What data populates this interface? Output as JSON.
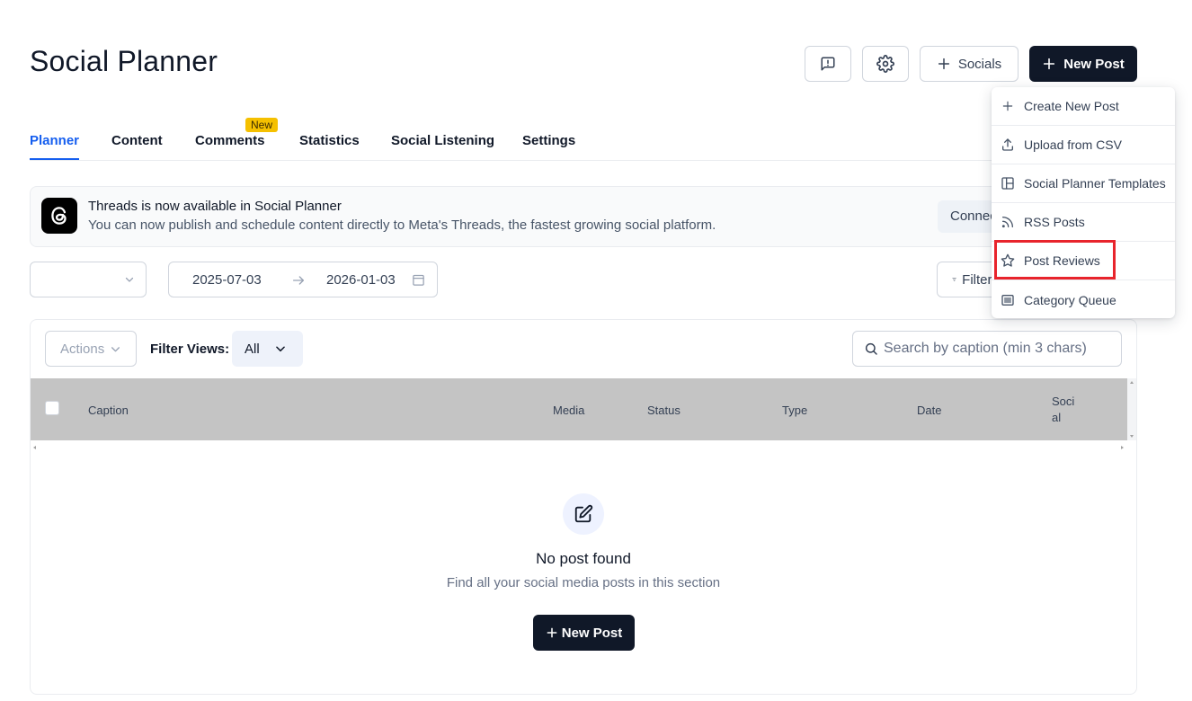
{
  "header": {
    "title": "Social Planner",
    "socials_label": "Socials",
    "new_post_label": "New Post"
  },
  "tabs": [
    {
      "label": "Planner",
      "active": true
    },
    {
      "label": "Content"
    },
    {
      "label": "Comments",
      "badge": "New"
    },
    {
      "label": "Statistics"
    },
    {
      "label": "Social Listening"
    },
    {
      "label": "Settings"
    }
  ],
  "banner": {
    "title": "Threads is now available in Social Planner",
    "text": "You can now publish and schedule content directly to Meta's Threads, the fastest growing social platform.",
    "connect_label": "Connect"
  },
  "filters": {
    "date_start": "2025-07-03",
    "date_end": "2026-01-03",
    "filter_label": "Filters"
  },
  "table": {
    "actions_label": "Actions",
    "filter_views_label": "Filter Views:",
    "filter_views_value": "All",
    "search_placeholder": "Search by caption (min 3 chars)",
    "columns": [
      "Caption",
      "Media",
      "Status",
      "Type",
      "Date",
      "Social"
    ]
  },
  "empty_state": {
    "title": "No post found",
    "subtitle": "Find all your social media posts in this section",
    "button_label": "New Post"
  },
  "dropdown": {
    "items": [
      {
        "label": "Create New Post",
        "icon": "plus-icon"
      },
      {
        "label": "Upload from CSV",
        "icon": "upload-icon"
      },
      {
        "label": "Social Planner Templates",
        "icon": "template-icon"
      },
      {
        "label": "RSS Posts",
        "icon": "rss-icon"
      },
      {
        "label": "Post Reviews",
        "icon": "star-icon",
        "highlighted": true
      },
      {
        "label": "Category Queue",
        "icon": "queue-icon"
      }
    ]
  },
  "colors": {
    "accent": "#155eef",
    "dark_button": "#101828",
    "badge": "#f5c000",
    "highlight": "#e8242c",
    "table_header": "#c4c4c4"
  }
}
